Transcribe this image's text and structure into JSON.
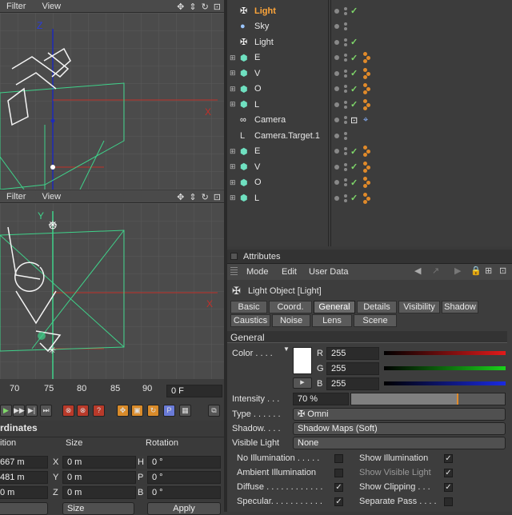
{
  "viewport_top": {
    "menu": [
      "Filter",
      "View"
    ],
    "icons": [
      "move-icon",
      "pan-icon",
      "rotate-icon",
      "maximize-icon"
    ],
    "axis": {
      "z": "Z",
      "x": "X"
    }
  },
  "viewport_bottom": {
    "menu": [
      "Filter",
      "View"
    ],
    "axis": {
      "y": "Y",
      "x": "X"
    }
  },
  "objects": [
    {
      "name": "Light",
      "icon": "light-icon",
      "selected": true,
      "check": "✓",
      "tags": 0
    },
    {
      "name": "Sky",
      "icon": "sky-icon",
      "selected": false,
      "check": "",
      "tags": 0
    },
    {
      "name": "Light",
      "icon": "light-icon",
      "selected": false,
      "check": "✓",
      "tags": 0
    },
    {
      "name": "E",
      "icon": "extrude-icon",
      "selected": false,
      "check": "✓",
      "tags": 3
    },
    {
      "name": "V",
      "icon": "extrude-icon",
      "selected": false,
      "check": "✓",
      "tags": 3
    },
    {
      "name": "O",
      "icon": "extrude-icon",
      "selected": false,
      "check": "✓",
      "tags": 3
    },
    {
      "name": "L",
      "icon": "extrude-icon",
      "selected": false,
      "check": "✓",
      "tags": 3
    },
    {
      "name": "Camera",
      "icon": "camera-icon",
      "selected": false,
      "check": "",
      "tags": 0
    },
    {
      "name": "Camera.Target.1",
      "icon": "null-icon",
      "selected": false,
      "check": "",
      "tags": 0
    },
    {
      "name": "E",
      "icon": "extrude-icon",
      "selected": false,
      "check": "✓",
      "tags": 3
    },
    {
      "name": "V",
      "icon": "extrude-icon",
      "selected": false,
      "check": "✓",
      "tags": 3
    },
    {
      "name": "O",
      "icon": "extrude-icon",
      "selected": false,
      "check": "✓",
      "tags": 3
    },
    {
      "name": "L",
      "icon": "extrude-icon",
      "selected": false,
      "check": "✓",
      "tags": 3
    }
  ],
  "attributes": {
    "title": "Attributes",
    "menu": [
      "Mode",
      "Edit",
      "User Data"
    ],
    "object_label": "Light Object [Light]",
    "tabs_row1": [
      "Basic",
      "Coord.",
      "General",
      "Details",
      "Visibility",
      "Shadow"
    ],
    "tabs_row2": [
      "Caustics",
      "Noise",
      "Lens",
      "Scene"
    ],
    "active_tab": "General",
    "section": "General",
    "color_label": "Color . . . .",
    "r_label": "R",
    "g_label": "G",
    "b_label": "B",
    "r": "255",
    "g": "255",
    "b": "255",
    "intensity_label": "Intensity . . .",
    "intensity": "70 %",
    "intensity_fraction": 0.7,
    "type_label": "Type . . . . . .",
    "type": "Omni",
    "shadow_label": "Shadow. . . .",
    "shadow": "Shadow Maps (Soft)",
    "visible_label": "Visible Light",
    "visible": "None",
    "checks_left": [
      {
        "label": "No Illumination . . . . .",
        "checked": false
      },
      {
        "label": "Ambient Illumination",
        "checked": false
      },
      {
        "label": "Diffuse . . . . . . . . . . . .",
        "checked": true
      },
      {
        "label": "Specular. . . . . . . . . . .",
        "checked": true
      }
    ],
    "checks_right": [
      {
        "label": "Show Illumination",
        "checked": true
      },
      {
        "label": "Show Visible Light",
        "checked": true
      },
      {
        "label": "Show Clipping . . .",
        "checked": true
      },
      {
        "label": "Separate Pass . . . .",
        "checked": false
      }
    ]
  },
  "timeline": {
    "ticks": [
      "70",
      "75",
      "80",
      "85",
      "90"
    ],
    "frame": "0 F"
  },
  "coords": {
    "title": "rdinates",
    "headers": [
      "ition",
      "Size",
      "Rotation"
    ],
    "rows": [
      {
        "pos": "667 m",
        "axis1": "X",
        "size": "0 m",
        "axis2": "H",
        "rot": "0 °"
      },
      {
        "pos": "481 m",
        "axis1": "Y",
        "size": "0 m",
        "axis2": "P",
        "rot": "0 °"
      },
      {
        "pos": "0 m",
        "axis1": "Z",
        "size": "0 m",
        "axis2": "B",
        "rot": "0 °"
      }
    ],
    "size_dropdown": "Size",
    "apply": "Apply"
  },
  "colors": {
    "accent": "#ffa63a",
    "green": "#7fd86a",
    "tag": "#e08a2a"
  }
}
